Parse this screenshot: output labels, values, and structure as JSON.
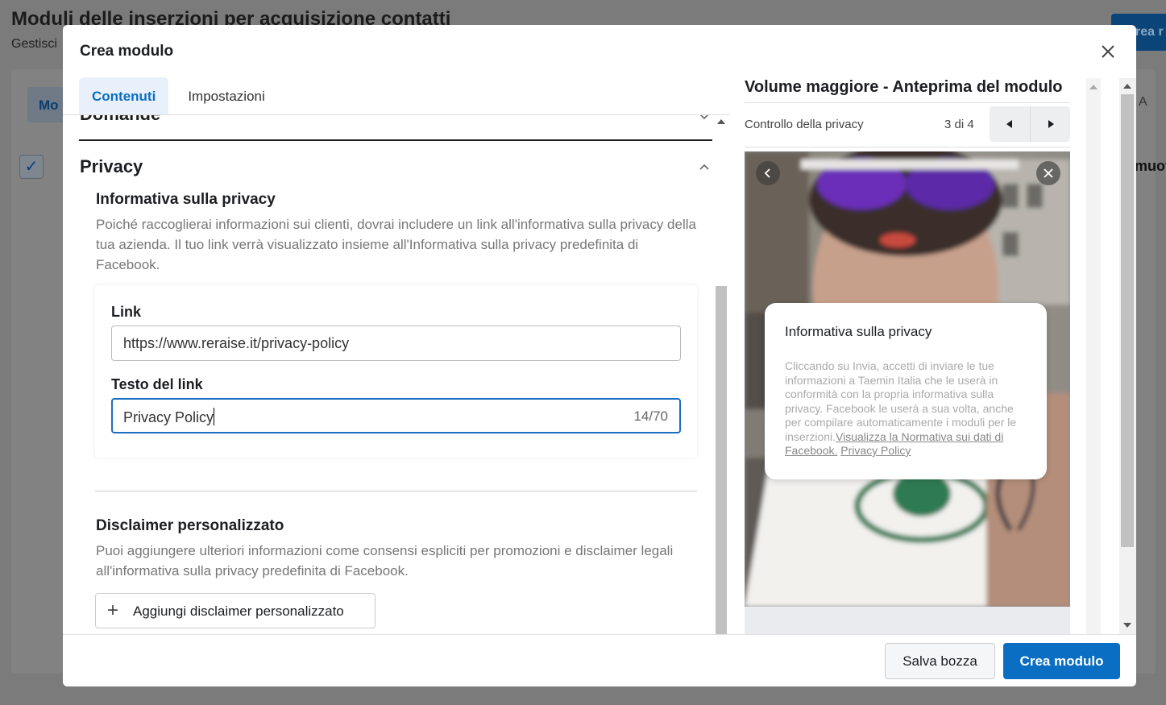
{
  "background": {
    "title": "Moduli delle inserzioni per acquisizione contatti",
    "subtitle": "Gestisci",
    "tab_partial": "Mo",
    "top_button_partial": "rea r",
    "right_partial_1": "A",
    "right_partial_2": "muov"
  },
  "modal": {
    "title": "Crea modulo",
    "tabs": [
      {
        "label": "Contenuti",
        "active": true
      },
      {
        "label": "Impostazioni",
        "active": false
      }
    ],
    "sections": {
      "domande": {
        "title": "Domande"
      },
      "privacy": {
        "title": "Privacy",
        "policy": {
          "title": "Informativa sulla privacy",
          "description": "Poiché raccoglierai informazioni sui clienti, dovrai includere un link all'informativa sulla privacy della tua azienda. Il tuo link verrà visualizzato insieme all'Informativa sulla privacy predefinita di Facebook.",
          "link_label": "Link",
          "link_value": "https://www.reraise.it/privacy-policy",
          "link_text_label": "Testo del link",
          "link_text_value": "Privacy Policy",
          "link_text_counter": "14/70"
        },
        "disclaimer": {
          "title": "Disclaimer personalizzato",
          "description": "Puoi aggiungere ulteriori informazioni come consensi espliciti per promozioni e disclaimer legali all'informativa sulla privacy predefinita di Facebook.",
          "add_button": "Aggiungi disclaimer personalizzato"
        }
      }
    },
    "preview": {
      "title": "Volume maggiore - Anteprima del modulo",
      "step_label": "Controllo della privacy",
      "step_count": "3 di 4",
      "card": {
        "title": "Informativa sulla privacy",
        "body": "Cliccando su Invia, accetti di inviare le tue informazioni a Taemin Italia che le userà in conformità con la propria informativa sulla privacy. Facebook le userà a sua volta, anche per compilare automaticamente i moduli per le inserzioni.",
        "link_1": "Visualizza la Normativa sui dati di Facebook.",
        "link_2": "Privacy Policy"
      }
    },
    "footer": {
      "save_draft": "Salva bozza",
      "create": "Crea modulo"
    }
  },
  "colors": {
    "primary": "#0a6fc2",
    "active_tab_bg": "#e8f1fb",
    "overlay": "#7b7b7b",
    "focus_border": "#1a6fc0"
  },
  "icons": [
    "close-icon",
    "chevron-up-icon",
    "chevron-down-icon",
    "triangle-left-icon",
    "triangle-right-icon",
    "plus-icon",
    "back-arrow-icon",
    "photo-close-icon"
  ]
}
